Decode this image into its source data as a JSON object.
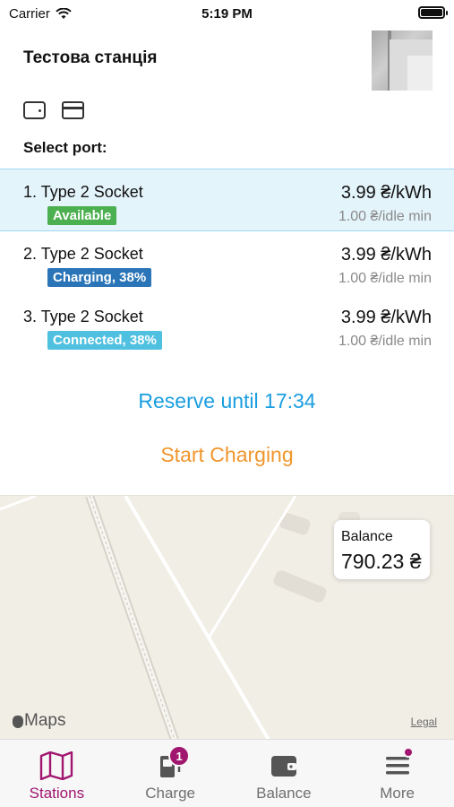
{
  "status_bar": {
    "carrier": "Carrier",
    "time": "5:19 PM"
  },
  "station": {
    "name": "Тестова станція"
  },
  "section_title": "Select port:",
  "ports": [
    {
      "title": "1.  Type 2 Socket",
      "status": "Available",
      "status_color": "#4caf50",
      "price": "3.99 ₴/kWh",
      "idle": "1.00 ₴/idle min",
      "selected": true
    },
    {
      "title": "2.  Type 2 Socket",
      "status": "Charging, 38%",
      "status_color": "#2a74b8",
      "price": "3.99 ₴/kWh",
      "idle": "1.00 ₴/idle min",
      "selected": false
    },
    {
      "title": "3.  Type 2 Socket",
      "status": "Connected, 38%",
      "status_color": "#4fc0e0",
      "price": "3.99 ₴/kWh",
      "idle": "1.00 ₴/idle min",
      "selected": false
    }
  ],
  "actions": {
    "reserve": "Reserve until 17:34",
    "start": "Start Charging"
  },
  "map": {
    "logo": "Maps",
    "legal": "Legal"
  },
  "balance": {
    "label": "Balance",
    "value": "790.23 ₴"
  },
  "tabs": [
    {
      "label": "Stations",
      "icon": "map-icon",
      "active": true
    },
    {
      "label": "Charge",
      "icon": "charger-icon",
      "badge": "1"
    },
    {
      "label": "Balance",
      "icon": "wallet-icon"
    },
    {
      "label": "More",
      "icon": "menu-icon",
      "dot": true
    }
  ],
  "colors": {
    "accent": "#a1166f",
    "link_blue": "#1a9ee0",
    "orange": "#f0962d",
    "selected_bg": "#e4f4fb"
  }
}
